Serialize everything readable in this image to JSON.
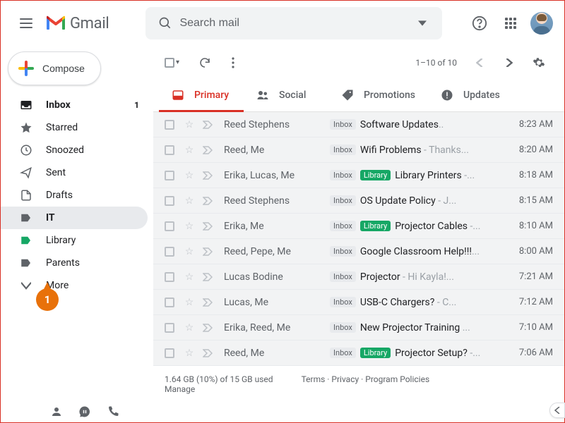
{
  "header": {
    "logo_text": "Gmail",
    "search_placeholder": "Search mail"
  },
  "compose_label": "Compose",
  "sidebar": {
    "items": [
      {
        "label": "Inbox",
        "count": "1"
      },
      {
        "label": "Starred"
      },
      {
        "label": "Snoozed"
      },
      {
        "label": "Sent"
      },
      {
        "label": "Drafts"
      },
      {
        "label": "IT"
      },
      {
        "label": "Library"
      },
      {
        "label": "Parents"
      },
      {
        "label": "More"
      }
    ]
  },
  "callout_number": "1",
  "toolbar": {
    "page_count": "1–10 of 10"
  },
  "tabs": [
    {
      "label": "Primary"
    },
    {
      "label": "Social"
    },
    {
      "label": "Promotions"
    },
    {
      "label": "Updates"
    }
  ],
  "rows": [
    {
      "sender": "Reed Stephens",
      "inbox": true,
      "lib": false,
      "title": "Software Updates",
      "preview": "..",
      "time": "8:23 AM"
    },
    {
      "sender": "Reed, Me",
      "inbox": true,
      "lib": false,
      "title": "Wifi Problems",
      "preview": " - Thanks...",
      "time": "8:20 AM"
    },
    {
      "sender": "Erika, Lucas, Me",
      "inbox": true,
      "lib": true,
      "title": "Library Printers",
      "preview": " -...",
      "time": "8:18 AM"
    },
    {
      "sender": "Reed Stephens",
      "inbox": true,
      "lib": false,
      "title": "OS Update Policy",
      "preview": " - J...",
      "time": "8:15 AM"
    },
    {
      "sender": "Erika, Me",
      "inbox": true,
      "lib": true,
      "title": "Projector Cables",
      "preview": " -...",
      "time": "8:10 AM"
    },
    {
      "sender": "Reed, Pepe, Me",
      "inbox": true,
      "lib": false,
      "title": "Google Classroom Help!!!",
      "preview": "...",
      "time": "8:00 AM"
    },
    {
      "sender": "Lucas Bodine",
      "inbox": true,
      "lib": false,
      "title": "Projector",
      "preview": " - Hi Kayla!...",
      "time": "7:21 AM"
    },
    {
      "sender": "Lucas, Me",
      "inbox": true,
      "lib": false,
      "title": "USB-C Chargers?",
      "preview": " - C...",
      "time": "7:12 AM"
    },
    {
      "sender": "Erika, Reed, Me",
      "inbox": true,
      "lib": false,
      "title": "New Projector Training ",
      "preview": "...",
      "time": "7:10 AM"
    },
    {
      "sender": "Reed, Me",
      "inbox": true,
      "lib": true,
      "title": "Projector Setup?",
      "preview": " -...",
      "time": "7:06 AM"
    }
  ],
  "footer": {
    "storage": "1.64 GB (10%) of 15 GB used",
    "manage": "Manage",
    "terms": "Terms",
    "privacy": "Privacy",
    "policies": "Program Policies"
  }
}
